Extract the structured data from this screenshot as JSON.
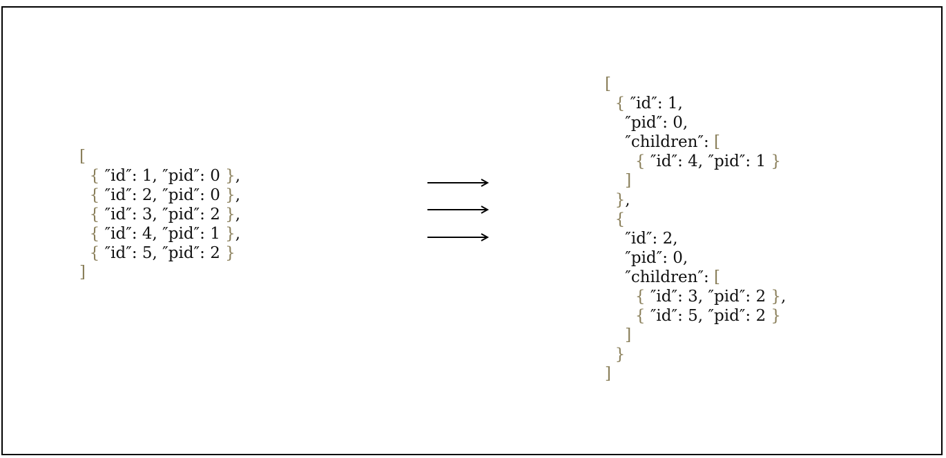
{
  "colors": {
    "text": "#111111",
    "brace": "#8a7f5a",
    "arrow": "#000000",
    "border": "#000000"
  },
  "input_json": {
    "lines": [
      [
        [
          "brace",
          "["
        ]
      ],
      [
        [
          "indent",
          "  "
        ],
        [
          "brace",
          "{"
        ],
        [
          "text",
          " ″id″: 1, ″pid″: 0 "
        ],
        [
          "brace",
          "}"
        ],
        [
          "text",
          ","
        ]
      ],
      [
        [
          "indent",
          "  "
        ],
        [
          "brace",
          "{"
        ],
        [
          "text",
          " ″id″: 2, ″pid″: 0 "
        ],
        [
          "brace",
          "}"
        ],
        [
          "text",
          ","
        ]
      ],
      [
        [
          "indent",
          "  "
        ],
        [
          "brace",
          "{"
        ],
        [
          "text",
          " ″id″: 3, ″pid″: 2 "
        ],
        [
          "brace",
          "}"
        ],
        [
          "text",
          ","
        ]
      ],
      [
        [
          "indent",
          "  "
        ],
        [
          "brace",
          "{"
        ],
        [
          "text",
          " ″id″: 4, ″pid″: 1 "
        ],
        [
          "brace",
          "}"
        ],
        [
          "text",
          ","
        ]
      ],
      [
        [
          "indent",
          "  "
        ],
        [
          "brace",
          "{"
        ],
        [
          "text",
          " ″id″: 5, ″pid″: 2 "
        ],
        [
          "brace",
          "}"
        ]
      ],
      [
        [
          "brace",
          "]"
        ]
      ]
    ]
  },
  "transform_arrows": {
    "count": 3,
    "icon": "right-arrow-icon"
  },
  "output_json": {
    "lines": [
      [
        [
          "brace",
          "["
        ]
      ],
      [
        [
          "indent",
          "  "
        ],
        [
          "brace",
          "{"
        ],
        [
          "text",
          " ″id″: 1,"
        ]
      ],
      [
        [
          "indent",
          "    "
        ],
        [
          "text",
          "″pid″: 0,"
        ]
      ],
      [
        [
          "indent",
          "    "
        ],
        [
          "text",
          "″children″: "
        ],
        [
          "brace",
          "["
        ]
      ],
      [
        [
          "indent",
          "      "
        ],
        [
          "brace",
          "{"
        ],
        [
          "text",
          " ″id″: 4, ″pid″: 1 "
        ],
        [
          "brace",
          "}"
        ]
      ],
      [
        [
          "indent",
          "    "
        ],
        [
          "brace",
          "]"
        ]
      ],
      [
        [
          "indent",
          "  "
        ],
        [
          "brace",
          "}"
        ],
        [
          "text",
          ","
        ]
      ],
      [
        [
          "indent",
          "  "
        ],
        [
          "brace",
          "{"
        ]
      ],
      [
        [
          "indent",
          "    "
        ],
        [
          "text",
          "″id″: 2,"
        ]
      ],
      [
        [
          "indent",
          "    "
        ],
        [
          "text",
          "″pid″: 0,"
        ]
      ],
      [
        [
          "indent",
          "    "
        ],
        [
          "text",
          "″children″: "
        ],
        [
          "brace",
          "["
        ]
      ],
      [
        [
          "indent",
          "      "
        ],
        [
          "brace",
          "{"
        ],
        [
          "text",
          " ″id″: 3, ″pid″: 2 "
        ],
        [
          "brace",
          "}"
        ],
        [
          "text",
          ","
        ]
      ],
      [
        [
          "indent",
          "      "
        ],
        [
          "brace",
          "{"
        ],
        [
          "text",
          " ″id″: 5, ″pid″: 2 "
        ],
        [
          "brace",
          "}"
        ]
      ],
      [
        [
          "indent",
          "    "
        ],
        [
          "brace",
          "]"
        ]
      ],
      [
        [
          "indent",
          "  "
        ],
        [
          "brace",
          "}"
        ]
      ],
      [
        [
          "brace",
          "]"
        ]
      ]
    ]
  }
}
